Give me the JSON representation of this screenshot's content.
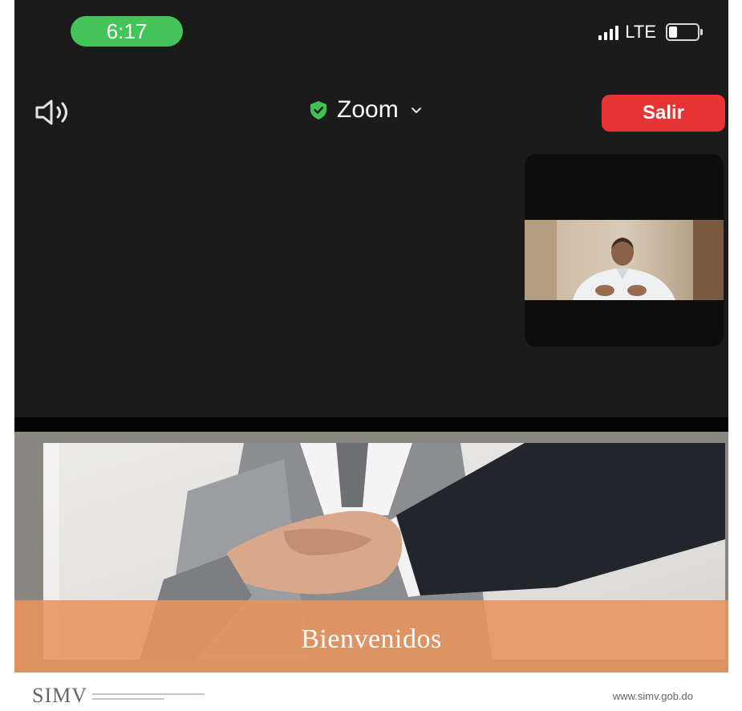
{
  "status_bar": {
    "time": "6:17",
    "network": "LTE",
    "colors": {
      "time_pill": "#45c45a"
    }
  },
  "header": {
    "speaker_icon": "speaker-icon",
    "meeting_title": "Zoom",
    "security_icon": "shield-icon",
    "leave_button_label": "Salir",
    "colors": {
      "leave_button": "#e63434",
      "shield": "#3fc24f"
    }
  },
  "shared_slide": {
    "banner_text": "Bienvenidos",
    "logo_text": "SIMV",
    "website": "www.simv.gob.do",
    "colors": {
      "banner": "#e8945c"
    }
  }
}
